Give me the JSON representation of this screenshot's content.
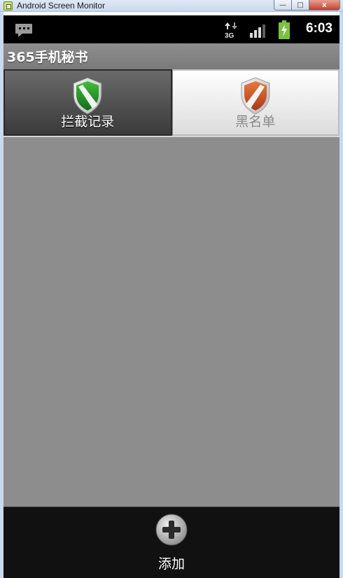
{
  "window": {
    "title": "Android Screen Monitor",
    "min_glyph": "—",
    "max_glyph": "□",
    "close_glyph": "x"
  },
  "status_bar": {
    "time": "6:03",
    "network": "3G",
    "icons": [
      "sms-icon",
      "network-3g-icon",
      "signal-icon",
      "battery-charging-icon"
    ]
  },
  "app": {
    "title": "365手机秘书"
  },
  "tabs": [
    {
      "label": "拦截记录",
      "icon": "green-shield-icon",
      "selected": true
    },
    {
      "label": "黑名单",
      "icon": "orange-shield-icon",
      "selected": false
    }
  ],
  "bottom": {
    "add_label": "添加",
    "add_icon": "plus-circle-icon"
  },
  "colors": {
    "content_bg": "#8c8d8c",
    "bottom_bar": "#111111",
    "shield_green": "#1f8f2a",
    "shield_orange": "#c9501e",
    "battery_green": "#7ac143"
  }
}
